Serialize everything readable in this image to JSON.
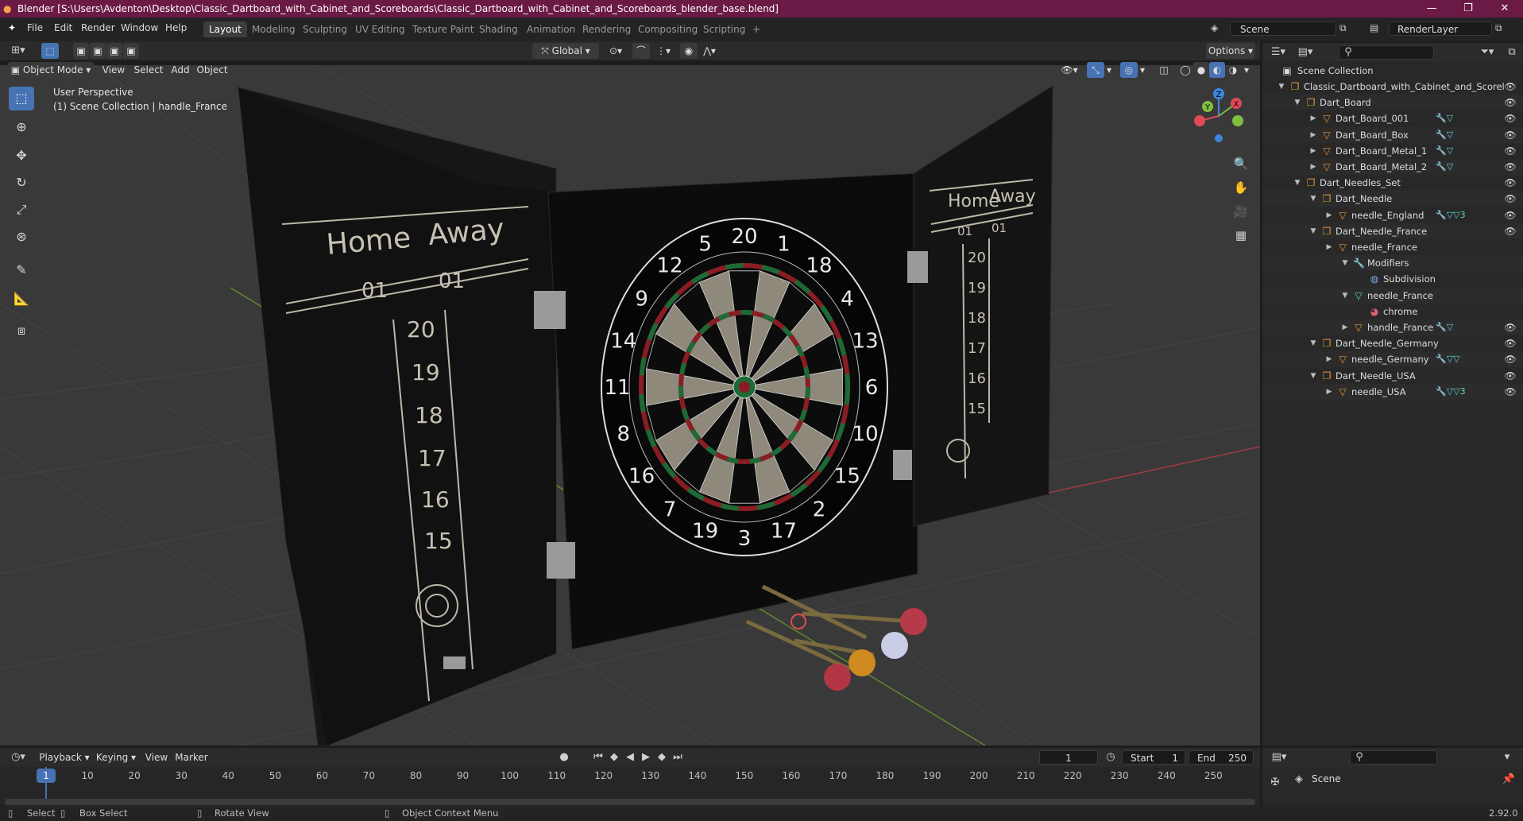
{
  "window": {
    "title": "Blender [S:\\Users\\Avdenton\\Desktop\\Classic_Dartboard_with_Cabinet_and_Scoreboards\\Classic_Dartboard_with_Cabinet_and_Scoreboards_blender_base.blend]",
    "controls": [
      "—",
      "❐",
      "✕"
    ]
  },
  "menubar": {
    "items": [
      "File",
      "Edit",
      "Render",
      "Window",
      "Help"
    ],
    "workspaces": [
      "Layout",
      "Modeling",
      "Sculpting",
      "UV Editing",
      "Texture Paint",
      "Shading",
      "Animation",
      "Rendering",
      "Compositing",
      "Scripting"
    ],
    "active_workspace": "Layout",
    "add_tab": "+",
    "scene": "Scene",
    "view_layer": "RenderLayer"
  },
  "viewport_header": {
    "transform_orientation": "Global",
    "options": "Options",
    "mode": "Object Mode",
    "menus": [
      "View",
      "Select",
      "Add",
      "Object"
    ]
  },
  "viewport": {
    "perspective": "User Perspective",
    "collection_info": "(1) Scene Collection | handle_France",
    "gizmo_axes": {
      "z": "Z",
      "y": "Y",
      "x": "X"
    },
    "scoreboard_left": {
      "home": "Home",
      "away": "Away",
      "home_start": "01",
      "away_start": "01",
      "numbers": [
        "20",
        "19",
        "18",
        "17",
        "16",
        "15"
      ]
    },
    "scoreboard_right": {
      "home": "Home",
      "away": "Away",
      "home_start": "01",
      "away_start": "01",
      "numbers": [
        "20",
        "19",
        "18",
        "17",
        "16",
        "15"
      ]
    },
    "dartboard_numbers": [
      "20",
      "1",
      "18",
      "4",
      "13",
      "6",
      "10",
      "15",
      "2",
      "17",
      "3",
      "19",
      "7",
      "16",
      "8",
      "11",
      "14",
      "9",
      "12",
      "5"
    ]
  },
  "tools": [
    "select-box",
    "cursor",
    "move",
    "rotate",
    "scale",
    "transform",
    "annotate",
    "measure",
    "add-cube"
  ],
  "outliner": {
    "root": "Scene Collection",
    "rows": [
      {
        "label": "Classic_Dartboard_with_Cabinet_and_Scorel",
        "indent": 0,
        "icon": "collection"
      },
      {
        "label": "Dart_Board",
        "indent": 1,
        "icon": "collection"
      },
      {
        "label": "Dart_Board_001",
        "indent": 2,
        "icon": "object",
        "tags": "🔧▽"
      },
      {
        "label": "Dart_Board_Box",
        "indent": 2,
        "icon": "object",
        "tags": "🔧▽"
      },
      {
        "label": "Dart_Board_Metal_1",
        "indent": 2,
        "icon": "object",
        "tags": "🔧▽"
      },
      {
        "label": "Dart_Board_Metal_2",
        "indent": 2,
        "icon": "object",
        "tags": "🔧▽"
      },
      {
        "label": "Dart_Needles_Set",
        "indent": 1,
        "icon": "collection"
      },
      {
        "label": "Dart_Needle",
        "indent": 2,
        "icon": "collection"
      },
      {
        "label": "needle_England",
        "indent": 3,
        "icon": "object",
        "tags": "🔧▽▽3"
      },
      {
        "label": "Dart_Needle_France",
        "indent": 2,
        "icon": "collection"
      },
      {
        "label": "needle_France",
        "indent": 3,
        "icon": "object"
      },
      {
        "label": "Modifiers",
        "indent": 4,
        "icon": "modifier"
      },
      {
        "label": "Subdivision",
        "indent": 5,
        "icon": "subdiv"
      },
      {
        "label": "needle_France",
        "indent": 4,
        "icon": "mesh"
      },
      {
        "label": "chrome",
        "indent": 5,
        "icon": "material"
      },
      {
        "label": "handle_France",
        "indent": 4,
        "icon": "object",
        "tags": "🔧▽"
      },
      {
        "label": "Dart_Needle_Germany",
        "indent": 2,
        "icon": "collection"
      },
      {
        "label": "needle_Germany",
        "indent": 3,
        "icon": "object",
        "tags": "🔧▽▽"
      },
      {
        "label": "Dart_Needle_USA",
        "indent": 2,
        "icon": "collection"
      },
      {
        "label": "needle_USA",
        "indent": 3,
        "icon": "object",
        "tags": "🔧▽▽3"
      }
    ]
  },
  "timeline": {
    "menus": [
      "Playback",
      "Keying",
      "View",
      "Marker"
    ],
    "current_frame": "1",
    "start_label": "Start",
    "start": "1",
    "end_label": "End",
    "end": "250",
    "ticks": [
      "1",
      "10",
      "20",
      "30",
      "40",
      "50",
      "60",
      "70",
      "80",
      "90",
      "100",
      "110",
      "120",
      "130",
      "140",
      "150",
      "160",
      "170",
      "180",
      "190",
      "200",
      "210",
      "220",
      "230",
      "240",
      "250"
    ]
  },
  "properties": {
    "scene": "Scene"
  },
  "statusbar": {
    "select": "Select",
    "box_select": "Box Select",
    "rotate_view": "Rotate View",
    "context_menu": "Object Context Menu",
    "version": "2.92.0"
  },
  "colors": {
    "title_bar": "#6b1a45",
    "active_blue": "#4772b3",
    "collection_orange": "#e8963c",
    "x_axis_red": "#e04a55",
    "y_axis_green": "#7fbf3f",
    "z_axis_blue": "#3d85e0"
  }
}
